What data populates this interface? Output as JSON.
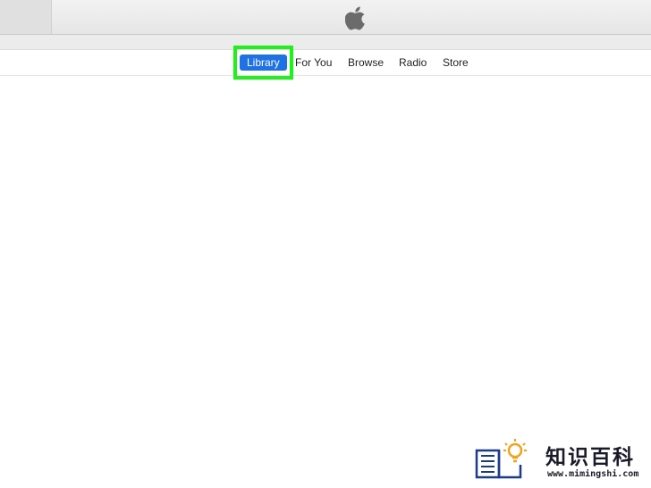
{
  "window": {
    "logo_icon": "apple-icon"
  },
  "nav": {
    "tabs": [
      {
        "label": "Library",
        "active": true
      },
      {
        "label": "For You",
        "active": false
      },
      {
        "label": "Browse",
        "active": false
      },
      {
        "label": "Radio",
        "active": false
      },
      {
        "label": "Store",
        "active": false
      }
    ],
    "active_color": "#1f72e5",
    "highlight_color": "#1ff218"
  },
  "watermark": {
    "title": "知识百科",
    "url": "www.mimingshi.com",
    "icon": "book-lightbulb-icon"
  }
}
